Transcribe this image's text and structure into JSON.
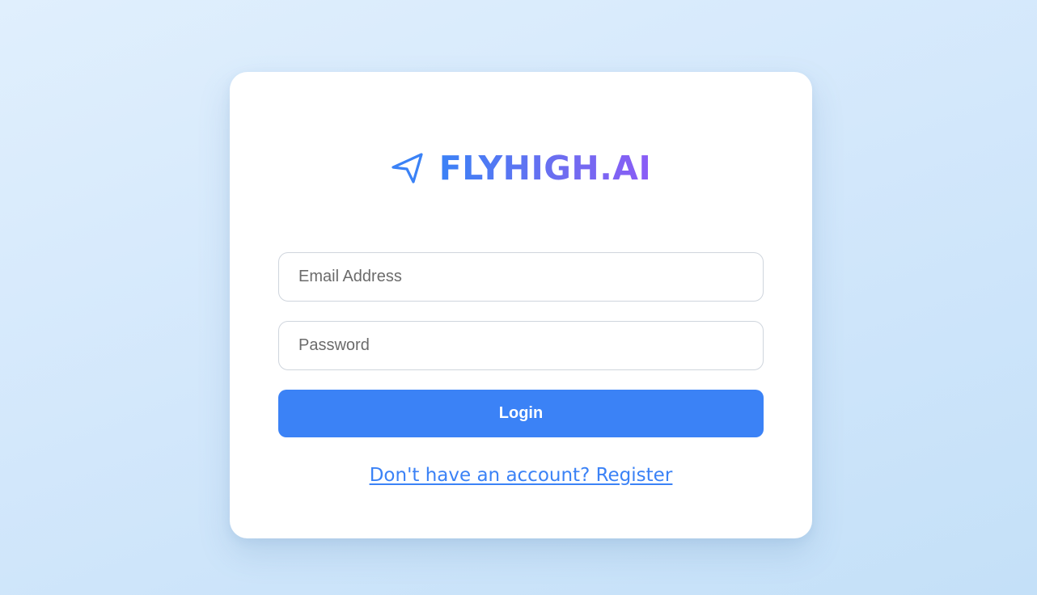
{
  "brand": {
    "name": "FLYHIGH.AI",
    "icon": "paper-plane-icon"
  },
  "form": {
    "email_placeholder": "Email Address",
    "email_value": "",
    "password_placeholder": "Password",
    "password_value": "",
    "login_label": "Login"
  },
  "footer": {
    "register_text": "Don't have an account? Register"
  },
  "colors": {
    "accent": "#3b82f6",
    "brand_gradient_end": "#8b5cf6",
    "card_background": "#ffffff",
    "page_background": "#d2e7fb"
  }
}
